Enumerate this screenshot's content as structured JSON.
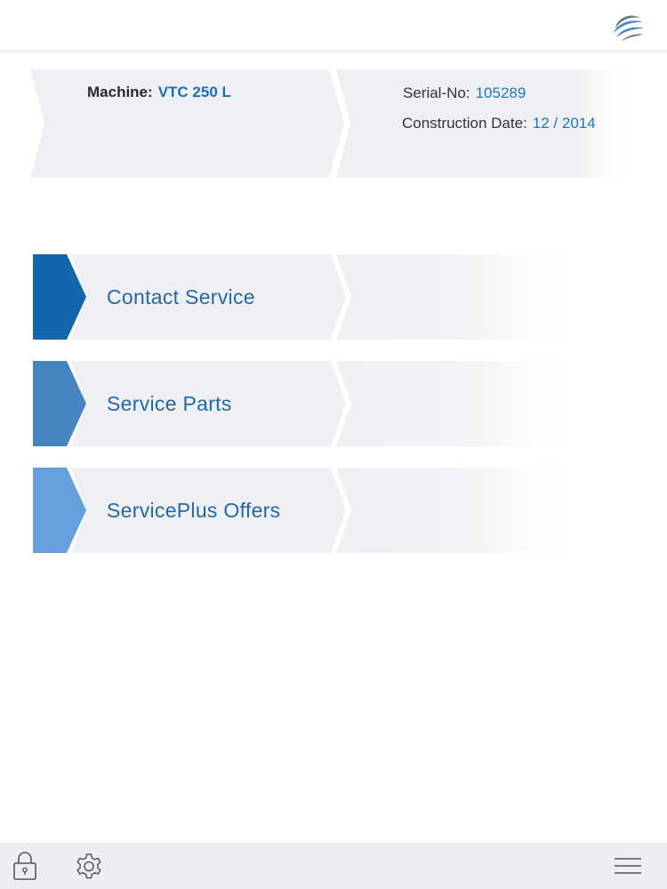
{
  "header": {
    "logo_icon": "globe-swoosh-logo-icon"
  },
  "machine": {
    "machine_label": "Machine:",
    "machine_value": "VTC 250 L",
    "serial_label": "Serial-No:",
    "serial_value": "105289",
    "date_label": "Construction Date:",
    "date_value": "12 / 2014"
  },
  "menu": {
    "items": [
      {
        "label": "Contact Service",
        "accent": "#1565ad"
      },
      {
        "label": "Service Parts",
        "accent": "#4784c2"
      },
      {
        "label": "ServicePlus Offers",
        "accent": "#66a0dc"
      }
    ]
  },
  "footer": {
    "lock_icon": "lock-icon",
    "settings_icon": "gear-icon",
    "menu_icon": "hamburger-menu-icon"
  },
  "colors": {
    "label_blue": "#2467a8",
    "value_blue": "#1b78b8",
    "panel_gray": "#eef0f3"
  }
}
